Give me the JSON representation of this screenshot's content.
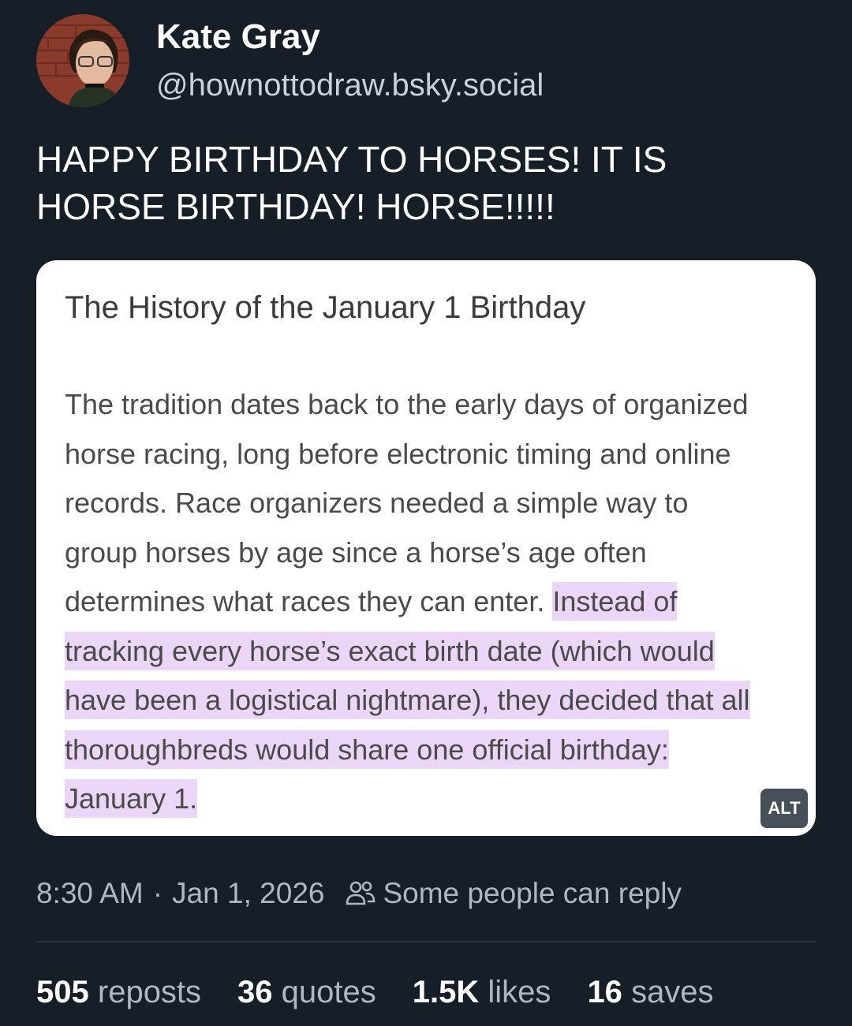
{
  "author": {
    "display_name": "Kate Gray",
    "handle": "@hownottodraw.bsky.social"
  },
  "post": {
    "text_lines": [
      "HAPPY BIRTHDAY TO HORSES! IT IS",
      "HORSE BIRTHDAY! HORSE!!!!!"
    ],
    "image": {
      "title": "The History of the January 1 Birthday",
      "lines": [
        {
          "plain": "The tradition dates back to the early days of organized",
          "highlight": ""
        },
        {
          "plain": "horse racing, long before electronic timing and online",
          "highlight": ""
        },
        {
          "plain": "records. Race organizers needed a simple way to",
          "highlight": ""
        },
        {
          "plain": "group horses by age since a horse’s age often",
          "highlight": ""
        },
        {
          "plain": "determines what races they can enter. ",
          "highlight": "Instead of"
        },
        {
          "plain": "",
          "highlight": "tracking every horse’s exact birth date (which would"
        },
        {
          "plain": "",
          "highlight": "have been a logistical nightmare), they decided that all"
        },
        {
          "plain": "",
          "highlight": "thoroughbreds would share one official birthday:"
        },
        {
          "plain": "",
          "highlight": "January 1."
        }
      ],
      "alt_label": "ALT",
      "highlight_color": "#ecd6f8"
    },
    "time": "8:30 AM",
    "separator": "·",
    "date": "Jan 1, 2026",
    "reply_icon": "people-icon",
    "reply_setting": "Some people can reply"
  },
  "stats": {
    "reposts": {
      "count": "505",
      "label": "reposts"
    },
    "quotes": {
      "count": "36",
      "label": "quotes"
    },
    "likes": {
      "count": "1.5K",
      "label": "likes"
    },
    "saves": {
      "count": "16",
      "label": "saves"
    }
  },
  "colors": {
    "background": "#161e27",
    "text": "#ffffff",
    "muted": "#aeb8c4",
    "alt_badge": "#474f59"
  }
}
